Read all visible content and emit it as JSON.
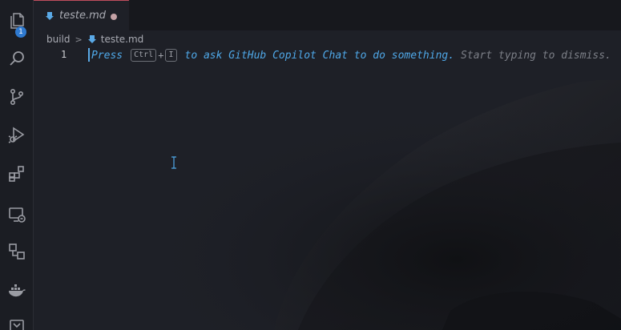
{
  "activity_bar": {
    "explorer_badge": "1",
    "items": [
      "files-icon",
      "search-icon",
      "source-control-icon",
      "run-debug-icon",
      "extensions-icon",
      "remote-explorer-icon",
      "project-manager-icon",
      "docker-icon",
      "tasks-icon"
    ]
  },
  "tab": {
    "label": "teste.md",
    "dirty": true
  },
  "breadcrumb": {
    "folder": "build",
    "separator": ">",
    "file": "teste.md"
  },
  "editor": {
    "line_number": "1",
    "hint": {
      "press": "Press",
      "key1": "Ctrl",
      "plus": "+",
      "key2": "I",
      "action": "to ask GitHub Copilot Chat to do something.",
      "dismiss": "Start typing to dismiss."
    }
  },
  "colors": {
    "accent": "#4fa8e8",
    "tab_border": "#c04d5d",
    "badge": "#2f7ad0"
  }
}
